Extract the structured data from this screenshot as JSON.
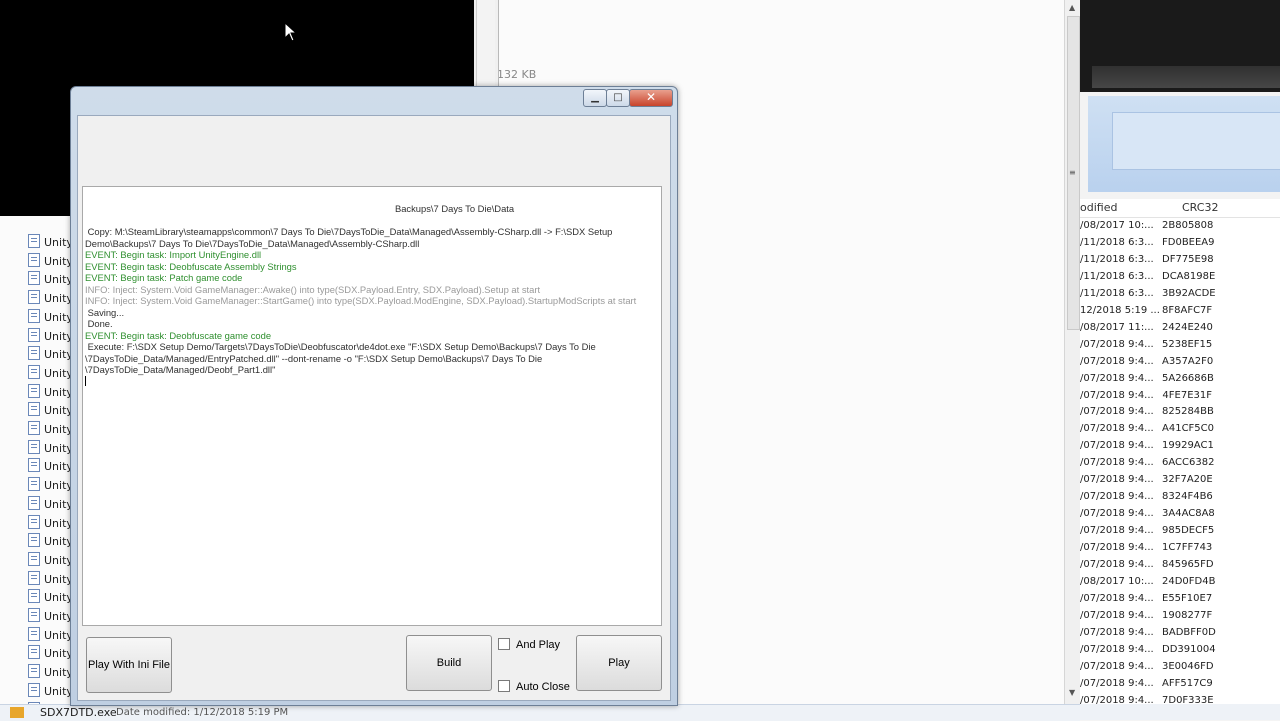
{
  "explorer": {
    "size_text": "132 KB",
    "left_rows": [
      "Unity",
      "Unity",
      "Unity",
      "Unity",
      "Unity",
      "Unity",
      "Unity",
      "Unity",
      "Unity",
      "Unity",
      "Unity",
      "Unity",
      "Unity",
      "Unity",
      "Unity",
      "Unity",
      "Unity",
      "Unity",
      "Unity",
      "Unity",
      "Unity",
      "Unity",
      "Unity",
      "Unity",
      "Unity",
      "Unity"
    ],
    "status_file": "SDX7DTD.exe",
    "status_date": "Date modified: 1/12/2018 5:19 PM"
  },
  "right_list": {
    "header_modified": "odified",
    "header_crc": "CRC32",
    "rows": [
      {
        "date": "/08/2017 10:...",
        "crc": "2B805808"
      },
      {
        "date": "/11/2018 6:3...",
        "crc": "FD0BEEA9"
      },
      {
        "date": "/11/2018 6:3...",
        "crc": "DF775E98"
      },
      {
        "date": "/11/2018 6:3...",
        "crc": "DCA8198E"
      },
      {
        "date": "/11/2018 6:3...",
        "crc": "3B92ACDE"
      },
      {
        "date": "12/2018 5:19 ...",
        "crc": "8F8AFC7F"
      },
      {
        "date": "/08/2017 11:...",
        "crc": "2424E240"
      },
      {
        "date": "/07/2018 9:4...",
        "crc": "5238EF15"
      },
      {
        "date": "/07/2018 9:4...",
        "crc": "A357A2F0"
      },
      {
        "date": "/07/2018 9:4...",
        "crc": "5A26686B"
      },
      {
        "date": "/07/2018 9:4...",
        "crc": "4FE7E31F"
      },
      {
        "date": "/07/2018 9:4...",
        "crc": "825284BB"
      },
      {
        "date": "/07/2018 9:4...",
        "crc": "A41CF5C0"
      },
      {
        "date": "/07/2018 9:4...",
        "crc": "19929AC1"
      },
      {
        "date": "/07/2018 9:4...",
        "crc": "6ACC6382"
      },
      {
        "date": "/07/2018 9:4...",
        "crc": "32F7A20E"
      },
      {
        "date": "/07/2018 9:4...",
        "crc": "8324F4B6"
      },
      {
        "date": "/07/2018 9:4...",
        "crc": "3A4AC8A8"
      },
      {
        "date": "/07/2018 9:4...",
        "crc": "985DECF5"
      },
      {
        "date": "/07/2018 9:4...",
        "crc": "1C7FF743"
      },
      {
        "date": "/07/2018 9:4...",
        "crc": "845965FD"
      },
      {
        "date": "/08/2017 10:...",
        "crc": "24D0FD4B"
      },
      {
        "date": "/07/2018 9:4...",
        "crc": "E55F10E7"
      },
      {
        "date": "/07/2018 9:4...",
        "crc": "1908277F"
      },
      {
        "date": "/07/2018 9:4...",
        "crc": "BADBFF0D"
      },
      {
        "date": "/07/2018 9:4...",
        "crc": "DD391004"
      },
      {
        "date": "/07/2018 9:4...",
        "crc": "3E0046FD"
      },
      {
        "date": "/07/2018 9:4...",
        "crc": "AFF517C9"
      },
      {
        "date": "/07/2018 9:4...",
        "crc": "7D0F333E"
      }
    ]
  },
  "app": {
    "log_lines": [
      {
        "level": "copy",
        "text": "                                                                                                                       Backups\\7 Days To Die\\Data"
      },
      {
        "level": "copy",
        "text": ""
      },
      {
        "level": "copy",
        "text": " Copy: M:\\SteamLibrary\\steamapps\\common\\7 Days To Die\\7DaysToDie_Data\\Managed\\Assembly-CSharp.dll -> F:\\SDX Setup"
      },
      {
        "level": "copy",
        "text": "Demo\\Backups\\7 Days To Die\\7DaysToDie_Data\\Managed\\Assembly-CSharp.dll"
      },
      {
        "level": "event",
        "text": "EVENT: Begin task: Import UnityEngine.dll"
      },
      {
        "level": "event",
        "text": "EVENT: Begin task: Deobfuscate Assembly Strings"
      },
      {
        "level": "event",
        "text": "EVENT: Begin task: Patch game code"
      },
      {
        "level": "info",
        "text": "INFO: Inject: System.Void GameManager::Awake() into type(SDX.Payload.Entry, SDX.Payload).Setup at start"
      },
      {
        "level": "info",
        "text": "INFO: Inject: System.Void GameManager::StartGame() into type(SDX.Payload.ModEngine, SDX.Payload).StartupModScripts at start"
      },
      {
        "level": "text",
        "text": " Saving..."
      },
      {
        "level": "text",
        "text": " Done."
      },
      {
        "level": "event",
        "text": "EVENT: Begin task: Deobfuscate game code"
      },
      {
        "level": "text",
        "text": " Execute: F:\\SDX Setup Demo/Targets\\7DaysToDie\\Deobfuscator\\de4dot.exe \"F:\\SDX Setup Demo\\Backups\\7 Days To Die"
      },
      {
        "level": "text",
        "text": "\\7DaysToDie_Data/Managed/EntryPatched.dll\" --dont-rename -o \"F:\\SDX Setup Demo\\Backups\\7 Days To Die"
      },
      {
        "level": "text",
        "text": "\\7DaysToDie_Data/Managed/Deobf_Part1.dll\""
      }
    ],
    "buttons": {
      "play_with_ini": "Play With Ini File",
      "build": "Build",
      "play": "Play",
      "and_play": "And Play",
      "auto_close": "Auto Close"
    },
    "titlebar": {
      "min": "▁",
      "max": "□",
      "close": "✕"
    }
  }
}
